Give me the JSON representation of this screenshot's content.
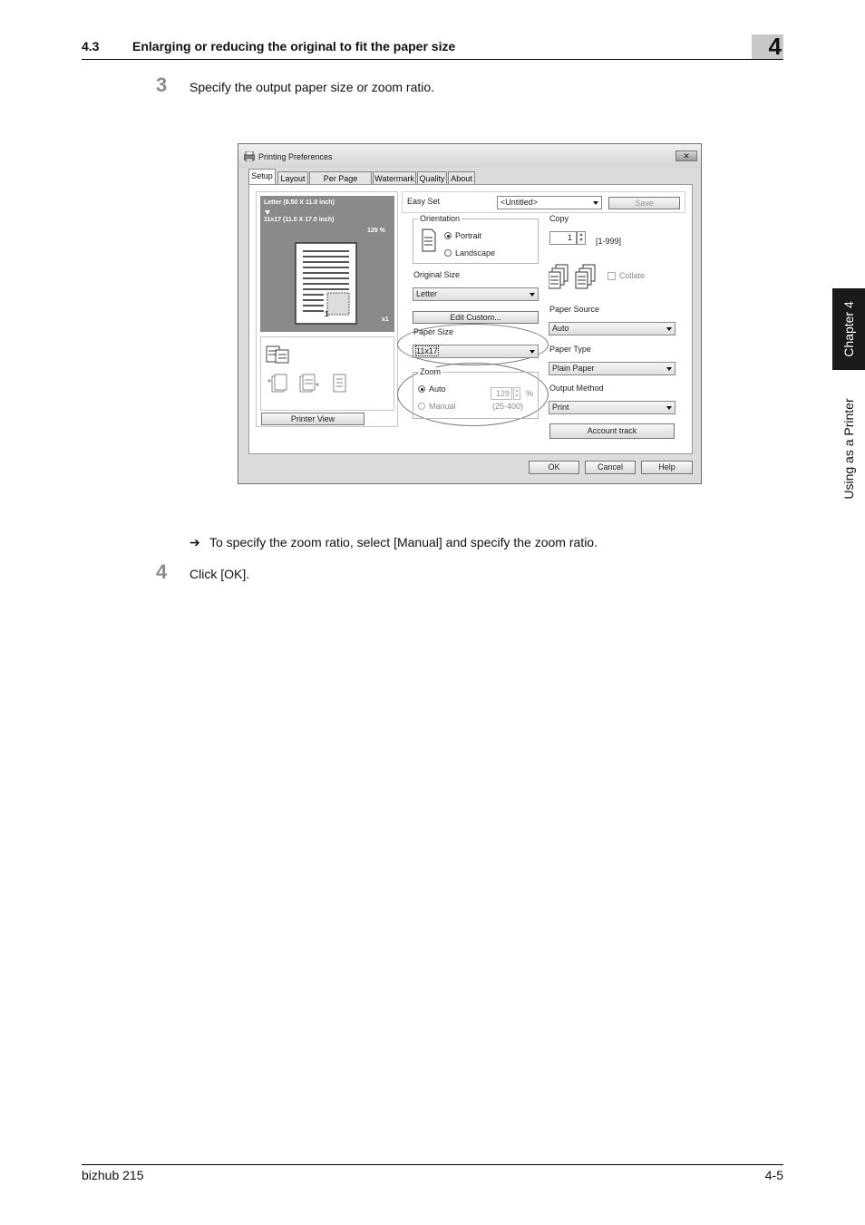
{
  "header": {
    "section_number": "4.3",
    "section_title": "Enlarging or reducing the original to fit the paper size",
    "chapter_number": "4"
  },
  "side_tab": {
    "chapter_label": "Chapter 4",
    "section_label": "Using as a Printer"
  },
  "steps": [
    {
      "number": "3",
      "text": "Specify the output paper size or zoom ratio."
    },
    {
      "number": "4",
      "text": "Click [OK]."
    }
  ],
  "bullet": {
    "arrow": "➔",
    "text": "To specify the zoom ratio, select [Manual] and specify the zoom ratio."
  },
  "footer": {
    "product": "bizhub 215",
    "page": "4-5"
  },
  "dialog": {
    "title": "Printing Preferences",
    "tabs": [
      "Setup",
      "Layout",
      "Per Page Setting",
      "Watermark",
      "Quality",
      "About"
    ],
    "preview": {
      "original": "Letter (8.50 X 11.0 inch)",
      "output": "11x17 (11.0 X 17.0 inch)",
      "zoom": "129 %",
      "copies": "x1",
      "page_number": "1"
    },
    "printer_view_button": "Printer View",
    "easy_set_label": "Easy Set",
    "easy_set_value": "<Untitled>",
    "save_button": "Save",
    "orientation_label": "Orientation",
    "portrait_label": "Portrait",
    "landscape_label": "Landscape",
    "original_size_label": "Original Size",
    "original_size_value": "Letter",
    "edit_custom_button": "Edit Custom...",
    "paper_size_label": "Paper Size",
    "paper_size_value": "11x17",
    "zoom_label": "Zoom",
    "zoom_auto_label": "Auto",
    "zoom_manual_label": "Manual",
    "zoom_value": "129",
    "zoom_unit": "%",
    "zoom_range": "(25-400)",
    "copy_label": "Copy",
    "copy_value": "1",
    "copy_range": "[1-999]",
    "collate_label": "Collate",
    "paper_source_label": "Paper Source",
    "paper_source_value": "Auto",
    "paper_type_label": "Paper Type",
    "paper_type_value": "Plain Paper",
    "output_method_label": "Output Method",
    "output_method_value": "Print",
    "account_track_button": "Account track",
    "ok_button": "OK",
    "cancel_button": "Cancel",
    "help_button": "Help"
  }
}
